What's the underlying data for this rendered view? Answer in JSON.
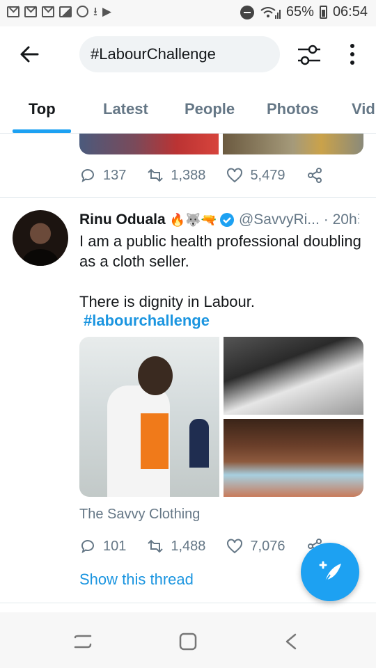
{
  "status_bar": {
    "battery": "65%",
    "time": "06:54",
    "icons": [
      "mail-icon",
      "mail-icon",
      "mail-icon",
      "image-icon",
      "dnd-icon",
      "download-icon",
      "play-icon"
    ]
  },
  "header": {
    "search_value": "#LabourChallenge",
    "icons": [
      "back-arrow-icon",
      "filter-icon",
      "more-icon"
    ]
  },
  "tabs": [
    {
      "label": "Top",
      "active": true
    },
    {
      "label": "Latest",
      "active": false
    },
    {
      "label": "People",
      "active": false
    },
    {
      "label": "Photos",
      "active": false
    },
    {
      "label": "Vid",
      "active": false
    }
  ],
  "previous_tweet": {
    "replies": "137",
    "retweets": "1,388",
    "likes": "5,479"
  },
  "tweet": {
    "name": "Rinu Oduala",
    "emoji": "🔥🐺🔫",
    "handle": "@SavvyRi...",
    "time": "· 20h",
    "text": "I am a public health professional doubling as a cloth seller.\n\nThere is dignity in Labour.",
    "hashtag": "#labourchallenge",
    "source": "The Savvy Clothing",
    "replies": "101",
    "retweets": "1,488",
    "likes": "7,076",
    "show_thread": "Show this thread"
  },
  "colors": {
    "accent": "#1da1f2",
    "link": "#1b95e0",
    "secondary_text": "#657786"
  }
}
